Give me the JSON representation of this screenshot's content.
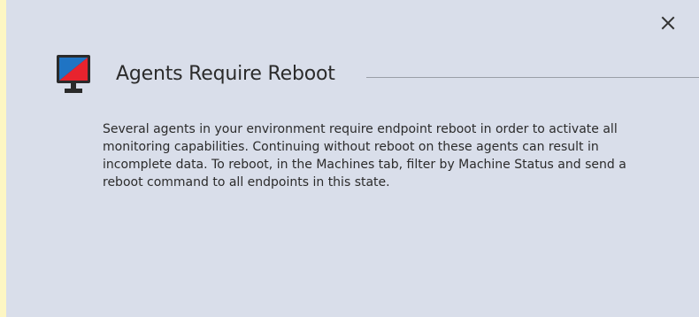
{
  "dialog": {
    "title": "Agents Require Reboot",
    "icon": "monitor-warning-icon",
    "close_icon": "close-icon",
    "message": "Several agents in your environment require endpoint reboot in order to activate all monitoring capabilities. Continuing without reboot on these agents can result in incomplete data. To reboot, in the Machines tab, filter by Machine Status and send a reboot command to all endpoints in this state."
  },
  "colors": {
    "dialog_background": "#d9deea",
    "page_background": "#fdf6c3",
    "icon_red": "#e8232e",
    "icon_blue": "#1f74c4",
    "icon_frame": "#2a2a2a",
    "text": "#2b2b2b",
    "rule": "#9a9fa8"
  }
}
